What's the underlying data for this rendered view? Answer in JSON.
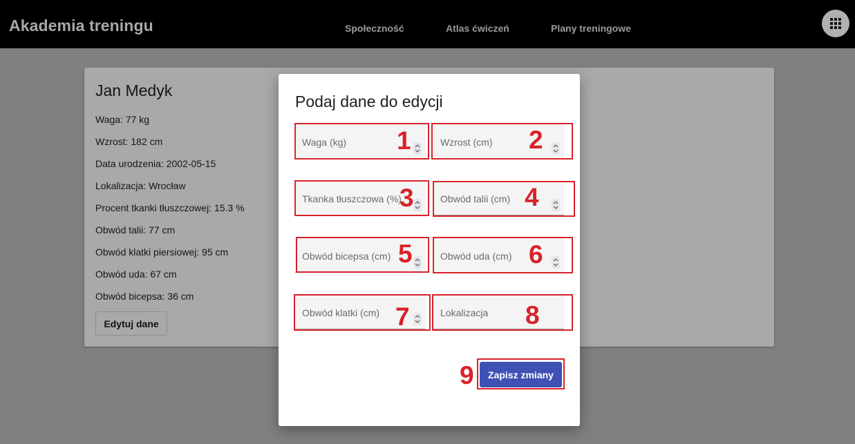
{
  "header": {
    "brand": "Akademia treningu",
    "nav": [
      "Społeczność",
      "Atlas ćwiczeń",
      "Plany treningowe"
    ],
    "apps_icon": "apps-grid-icon"
  },
  "profile": {
    "name": "Jan Medyk",
    "rows": [
      "Waga: 77 kg",
      "Wzrost: 182 cm",
      "Data urodzenia: 2002-05-15",
      "Lokalizacja: Wrocław",
      "Procent tkanki tłuszczowej: 15.3 %",
      "Obwód talii: 77 cm",
      "Obwód klatki piersiowej: 95 cm",
      "Obwód uda: 67 cm",
      "Obwód bicepsa: 36 cm"
    ],
    "edit_button": "Edytuj dane"
  },
  "modal": {
    "title": "Podaj dane do edycji",
    "fields": [
      {
        "label": "Waga (kg)",
        "type": "number",
        "marker": "1"
      },
      {
        "label": "Wzrost (cm)",
        "type": "number",
        "marker": "2"
      },
      {
        "label": "Tkanka tłuszczowa (%)",
        "type": "number",
        "marker": "3"
      },
      {
        "label": "Obwód talii (cm)",
        "type": "number",
        "marker": "4"
      },
      {
        "label": "Obwód bicepsa (cm)",
        "type": "number",
        "marker": "5"
      },
      {
        "label": "Obwód uda (cm)",
        "type": "number",
        "marker": "6"
      },
      {
        "label": "Obwód klatki (cm)",
        "type": "number",
        "marker": "7"
      },
      {
        "label": "Lokalizacja",
        "type": "text",
        "marker": "8"
      }
    ],
    "save_button": "Zapisz zmiany",
    "save_marker": "9"
  },
  "colors": {
    "accent": "#3f51b5",
    "annotation": "#d8222a",
    "topbar": "#000000"
  }
}
